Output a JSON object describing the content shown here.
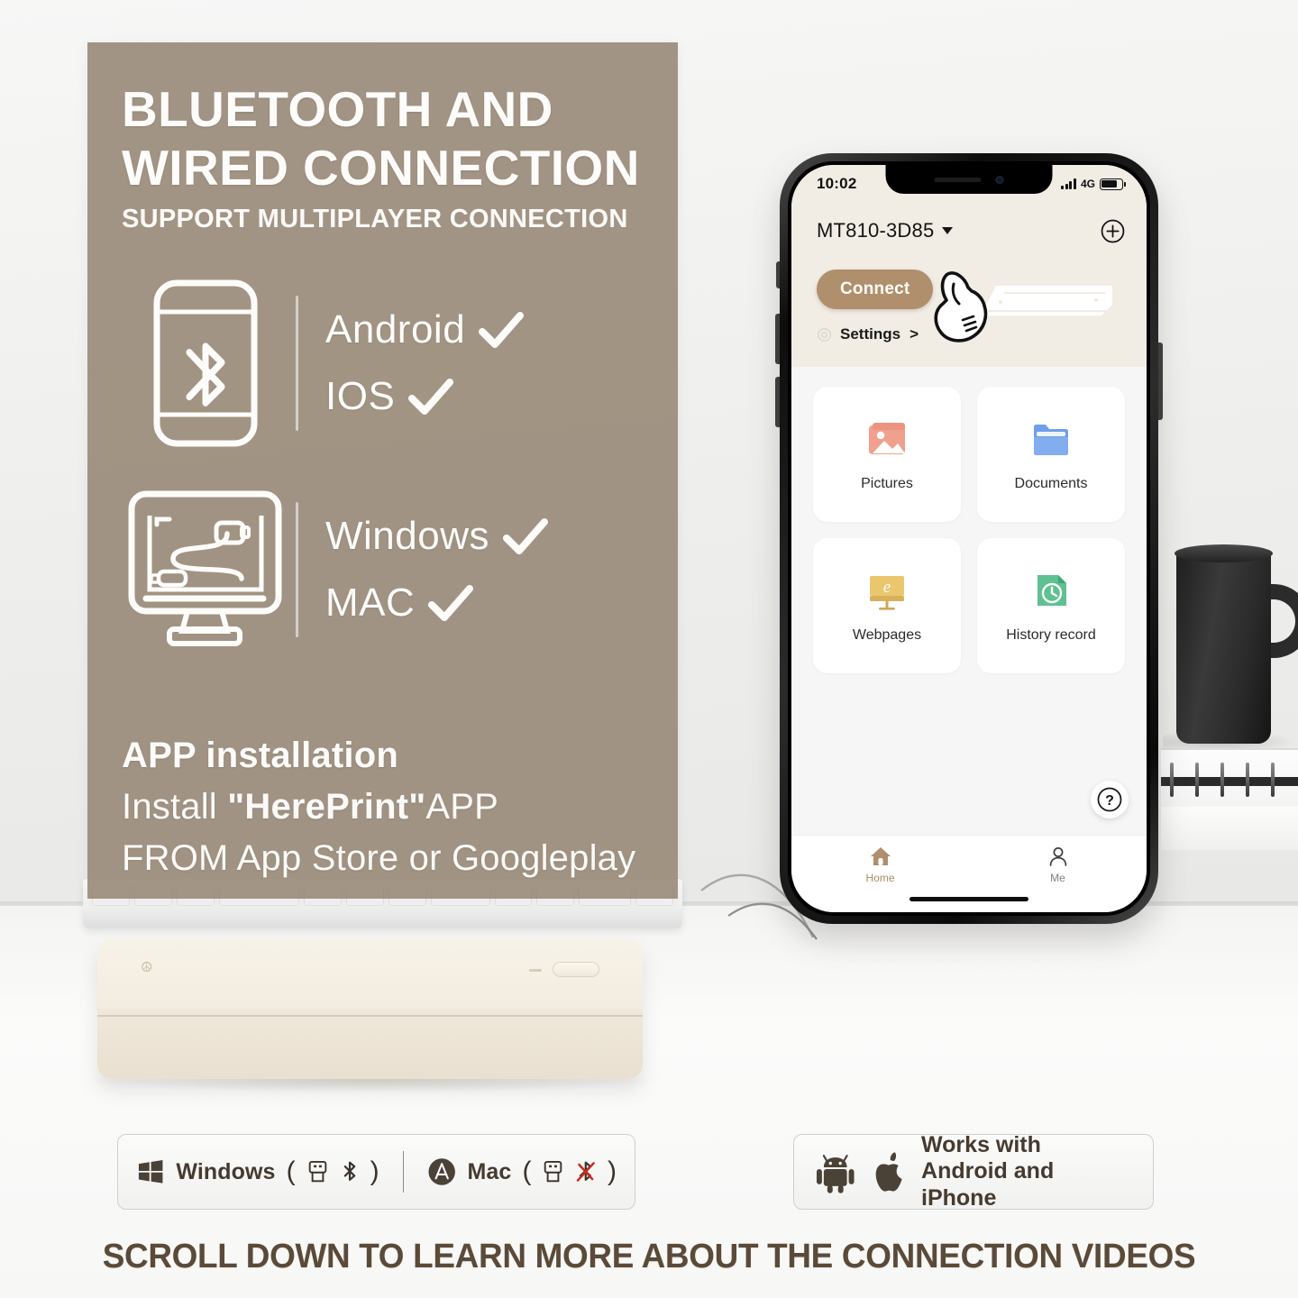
{
  "poster": {
    "headline_line1": "BLUETOOTH AND",
    "headline_line2": "WIRED CONNECTION",
    "subhead": "SUPPORT MULTIPLAYER CONNECTION",
    "bluetooth_icon": "phone-bluetooth-icon",
    "wired_icon": "monitor-usb-cable-icon",
    "os_bluetooth": [
      {
        "label": "Android",
        "check": "check-icon"
      },
      {
        "label": "IOS",
        "check": "check-icon"
      }
    ],
    "os_wired": [
      {
        "label": "Windows",
        "check": "check-icon"
      },
      {
        "label": "MAC",
        "check": "check-icon"
      }
    ],
    "install_title": "APP installation",
    "install_line1_pre": "Install ",
    "install_line1_app": "\"HerePrint\"",
    "install_line1_post": "APP",
    "install_line2": "FROM App Store or Googleplay",
    "bg_color": "#968674"
  },
  "phone": {
    "status": {
      "time": "10:02",
      "network": "4G",
      "signal_icon": "signal-bars-icon",
      "battery_icon": "battery-icon"
    },
    "header": {
      "device_name": "MT810-3D85",
      "caret_icon": "chevron-down-icon",
      "add_icon": "plus-circle-icon"
    },
    "connect_card": {
      "connect_label": "Connect",
      "settings_label": "Settings",
      "settings_chevron": ">",
      "gear_icon": "gear-icon",
      "hand_icon": "pointing-hand-icon",
      "printer_icon": "printer-device-icon",
      "accent_color": "#b08f6d",
      "card_bg": "#f1ece4"
    },
    "tiles": [
      {
        "label": "Pictures",
        "icon": "picture-icon",
        "color": "#f0a08c"
      },
      {
        "label": "Documents",
        "icon": "folder-icon",
        "color": "#7ba7e8"
      },
      {
        "label": "Webpages",
        "icon": "browser-icon",
        "color": "#e8c471"
      },
      {
        "label": "History record",
        "icon": "history-icon",
        "color": "#5fc191"
      }
    ],
    "help_label": "?",
    "tabs": [
      {
        "label": "Home",
        "icon": "home-icon",
        "active": true
      },
      {
        "label": "Me",
        "icon": "person-icon",
        "active": false
      }
    ]
  },
  "badges": {
    "windows": {
      "os_icon": "windows-logo-icon",
      "label": "Windows",
      "open_paren": "(",
      "usb_icon": "usb-icon",
      "bluetooth_icon": "bluetooth-icon",
      "close_paren": ")"
    },
    "mac": {
      "os_icon": "app-store-icon",
      "label": "Mac",
      "open_paren": "(",
      "usb_icon": "usb-icon",
      "bluetooth_icon": "bluetooth-crossed-out-icon",
      "close_paren": ")"
    },
    "works_with": {
      "android_icon": "android-robot-icon",
      "apple_icon": "apple-logo-icon",
      "line1": "Works with",
      "line2": "Android and iPhone"
    }
  },
  "footer": {
    "caption": "SCROLL DOWN TO LEARN MORE ABOUT THE CONNECTION VIDEOS"
  }
}
